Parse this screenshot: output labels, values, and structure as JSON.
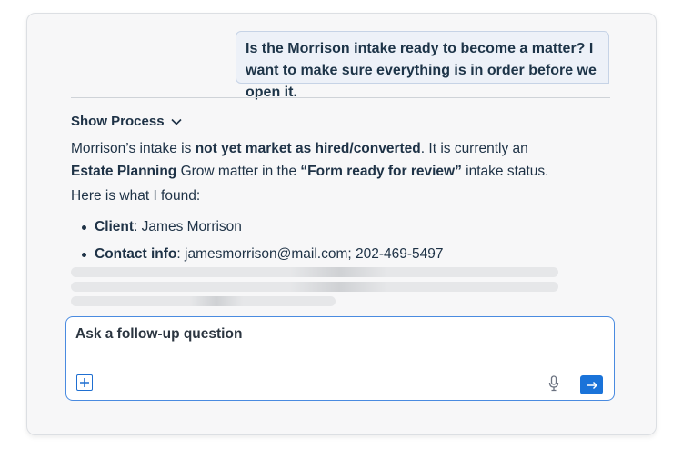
{
  "chat": {
    "user_message": "Is the Morrison intake ready to become a matter?  I want to make sure everything is in order before we open it.",
    "show_process_label": "Show Process",
    "answer": {
      "line1_pre": "Morrison’s intake is ",
      "line1_bold": "not yet market as hired/converted",
      "line1_post": ". It is currently an",
      "line2_bold1": "Estate Planning",
      "line2_mid": " Grow matter in the ",
      "line2_bold2": "“Form ready for review”",
      "line2_post": " intake status."
    },
    "found_label": "Here is what I found:",
    "bullets": [
      {
        "label": "Client",
        "value": ": James Morrison"
      },
      {
        "label": "Contact info",
        "value": ": jamesmorrison@mail.com; 202-469-5497"
      }
    ]
  },
  "composer": {
    "placeholder": "Ask a follow-up question"
  },
  "colors": {
    "accent": "#1a73d9",
    "bubble_bg": "#edf1f8",
    "text": "#1e3246"
  },
  "icons": {
    "show_process": "chevron-down-icon",
    "attach": "plus-square-icon",
    "voice": "microphone-icon",
    "send": "arrow-right-icon"
  }
}
